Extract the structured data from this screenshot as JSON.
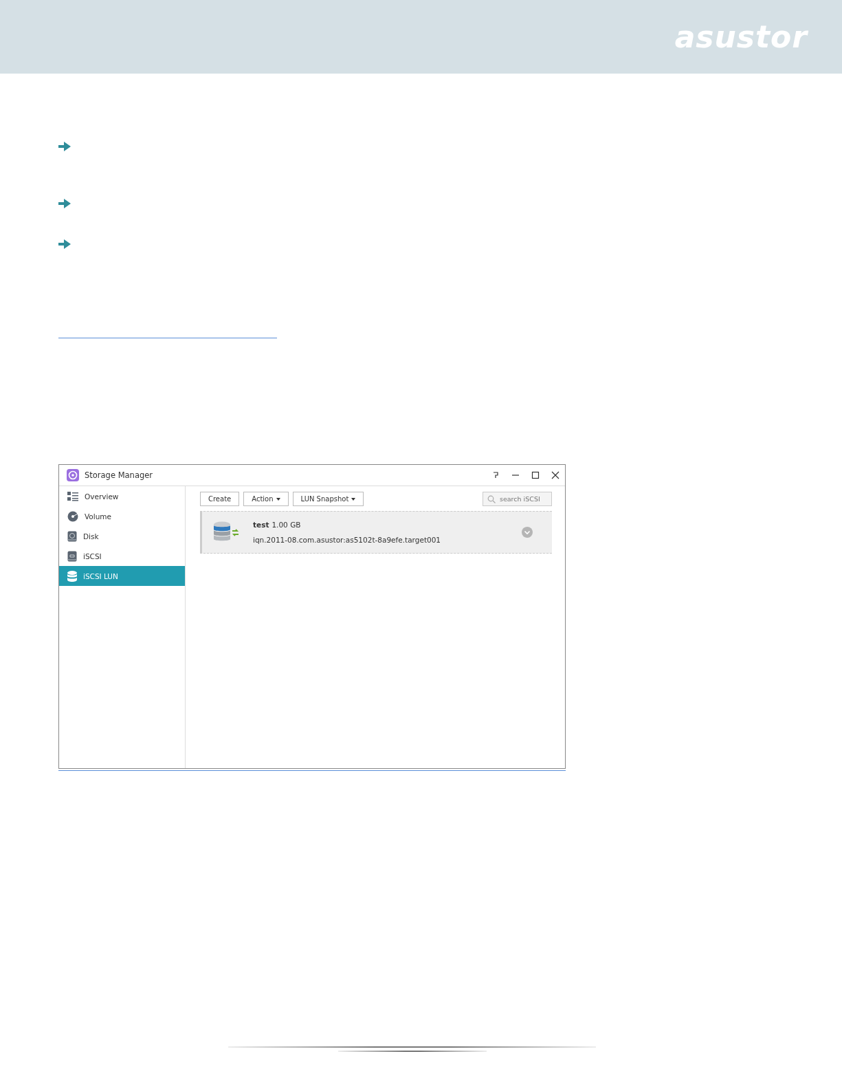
{
  "header": {
    "logo": "asustor"
  },
  "window": {
    "title": "Storage Manager"
  },
  "sidebar": {
    "items": [
      {
        "label": "Overview",
        "kind": "overview",
        "selected": false
      },
      {
        "label": "Volume",
        "kind": "volume",
        "selected": false
      },
      {
        "label": "Disk",
        "kind": "disk",
        "selected": false
      },
      {
        "label": "iSCSI",
        "kind": "iscsi",
        "selected": false
      },
      {
        "label": "iSCSI LUN",
        "kind": "lun",
        "selected": true
      }
    ]
  },
  "toolbar": {
    "buttons": [
      {
        "label": "Create",
        "dropdown": false
      },
      {
        "label": "Action",
        "dropdown": true
      },
      {
        "label": "LUN Snapshot",
        "dropdown": true
      }
    ],
    "search": {
      "placeholder": "search iSCSI"
    }
  },
  "luns": [
    {
      "name": "test",
      "size": "1.00 GB",
      "iqn": "iqn.2011-08.com.asustor:as5102t-8a9efe.target001"
    }
  ]
}
